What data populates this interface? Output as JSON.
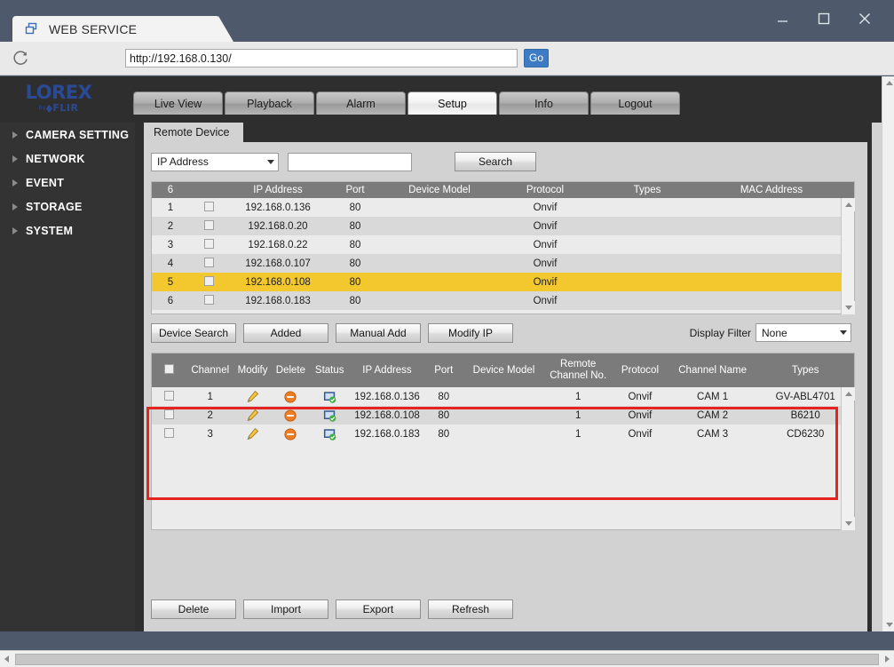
{
  "window": {
    "browser_tab_title": "WEB SERVICE",
    "tab_icon": "window-restore-icon",
    "minimize_icon": "minimize-icon",
    "maximize_icon": "maximize-icon",
    "close_icon": "close-icon",
    "reload_icon": "reload-icon",
    "url": "http://192.168.0.130/",
    "url_placeholder": "Enter address",
    "go_label": "Go"
  },
  "brand": {
    "name": "LOREX",
    "sub_by": "by",
    "sub_name": "FLIR"
  },
  "nav": {
    "tabs": [
      {
        "label": "Live View",
        "active": false
      },
      {
        "label": "Playback",
        "active": false
      },
      {
        "label": "Alarm",
        "active": false
      },
      {
        "label": "Setup",
        "active": true
      },
      {
        "label": "Info",
        "active": false
      },
      {
        "label": "Logout",
        "active": false
      }
    ]
  },
  "sidebar": {
    "items": [
      {
        "label": "CAMERA SETTING"
      },
      {
        "label": "NETWORK"
      },
      {
        "label": "EVENT"
      },
      {
        "label": "STORAGE"
      },
      {
        "label": "SYSTEM"
      }
    ]
  },
  "subtab": {
    "label": "Remote Device"
  },
  "filter": {
    "select_value": "IP Address",
    "search_value": "",
    "search_placeholder": "",
    "search_button": "Search"
  },
  "device_table": {
    "count_header": "6",
    "columns": [
      "IP Address",
      "Port",
      "Device Model",
      "Protocol",
      "Types",
      "MAC Address"
    ],
    "rows": [
      {
        "no": "1",
        "ip": "192.168.0.136",
        "port": "80",
        "model": "",
        "protocol": "Onvif",
        "types": "",
        "mac": "",
        "selected": false
      },
      {
        "no": "2",
        "ip": "192.168.0.20",
        "port": "80",
        "model": "",
        "protocol": "Onvif",
        "types": "",
        "mac": "",
        "selected": false
      },
      {
        "no": "3",
        "ip": "192.168.0.22",
        "port": "80",
        "model": "",
        "protocol": "Onvif",
        "types": "",
        "mac": "",
        "selected": false
      },
      {
        "no": "4",
        "ip": "192.168.0.107",
        "port": "80",
        "model": "",
        "protocol": "Onvif",
        "types": "",
        "mac": "",
        "selected": false
      },
      {
        "no": "5",
        "ip": "192.168.0.108",
        "port": "80",
        "model": "",
        "protocol": "Onvif",
        "types": "",
        "mac": "",
        "selected": true
      },
      {
        "no": "6",
        "ip": "192.168.0.183",
        "port": "80",
        "model": "",
        "protocol": "Onvif",
        "types": "",
        "mac": "",
        "selected": false
      }
    ]
  },
  "mid_buttons": [
    {
      "label": "Device Search"
    },
    {
      "label": "Added"
    },
    {
      "label": "Manual Add"
    },
    {
      "label": "Modify IP"
    }
  ],
  "display_filter": {
    "label": "Display Filter",
    "value": "None"
  },
  "added_table": {
    "columns": [
      "Channel",
      "Modify",
      "Delete",
      "Status",
      "IP Address",
      "Port",
      "Device Model",
      "Remote Channel No.",
      "Protocol",
      "Channel Name",
      "Types"
    ],
    "remote_channel_line1": "Remote",
    "remote_channel_line2": "Channel No.",
    "rows": [
      {
        "channel": "1",
        "modify_icon": "pencil-icon",
        "delete_icon": "remove-circle-icon",
        "status_icon": "monitor-ok-icon",
        "ip": "192.168.0.136",
        "port": "80",
        "model": "",
        "remote_channel": "1",
        "protocol": "Onvif",
        "name": "CAM 1",
        "types": "GV-ABL4701"
      },
      {
        "channel": "2",
        "modify_icon": "pencil-icon",
        "delete_icon": "remove-circle-icon",
        "status_icon": "monitor-ok-icon",
        "ip": "192.168.0.108",
        "port": "80",
        "model": "",
        "remote_channel": "1",
        "protocol": "Onvif",
        "name": "CAM 2",
        "types": "B6210"
      },
      {
        "channel": "3",
        "modify_icon": "pencil-icon",
        "delete_icon": "remove-circle-icon",
        "status_icon": "monitor-ok-icon",
        "ip": "192.168.0.183",
        "port": "80",
        "model": "",
        "remote_channel": "1",
        "protocol": "Onvif",
        "name": "CAM 3",
        "types": "CD6230"
      }
    ]
  },
  "bottom_buttons": [
    {
      "label": "Delete"
    },
    {
      "label": "Import"
    },
    {
      "label": "Export"
    },
    {
      "label": "Refresh"
    }
  ],
  "colors": {
    "highlight_row": "#f2c82e",
    "annotation_box": "#e52421",
    "brand_blue": "#2b4a96",
    "go_button": "#3d7cc4",
    "titlebar": "#4e5a6b"
  }
}
